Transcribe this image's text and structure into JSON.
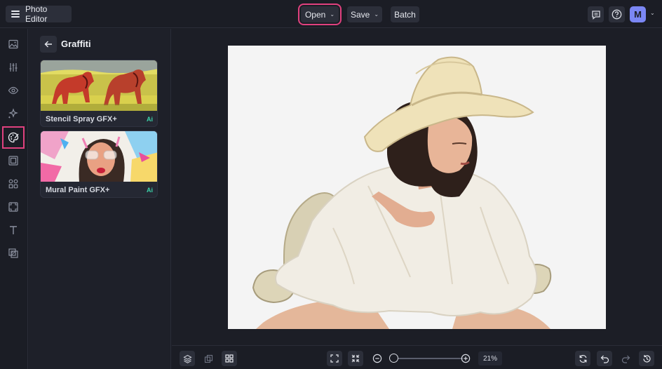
{
  "app": {
    "title": "Photo Editor"
  },
  "toolbar": {
    "open_label": "Open",
    "save_label": "Save",
    "batch_label": "Batch",
    "avatar_initial": "M"
  },
  "sidebar": {
    "items": [
      {
        "icon": "image-icon"
      },
      {
        "icon": "adjust-sliders-icon"
      },
      {
        "icon": "eye-icon"
      },
      {
        "icon": "sparkle-effects-icon"
      },
      {
        "icon": "palette-artsy-icon",
        "active": true
      },
      {
        "icon": "frame-icon"
      },
      {
        "icon": "shapes-icon"
      },
      {
        "icon": "texture-icon"
      },
      {
        "icon": "text-icon"
      },
      {
        "icon": "overlay-icon"
      }
    ]
  },
  "panel": {
    "title": "Graffiti",
    "effects": [
      {
        "label": "Stencil Spray GFX+",
        "badge": "Ai"
      },
      {
        "label": "Mural Paint GFX+",
        "badge": "Ai"
      }
    ]
  },
  "bottom": {
    "zoom": "21%"
  },
  "colors": {
    "accent": "#e0417e",
    "avatar": "#7b87f4",
    "ai_badge": "#3bd1a8",
    "background": "#1c1e26"
  }
}
